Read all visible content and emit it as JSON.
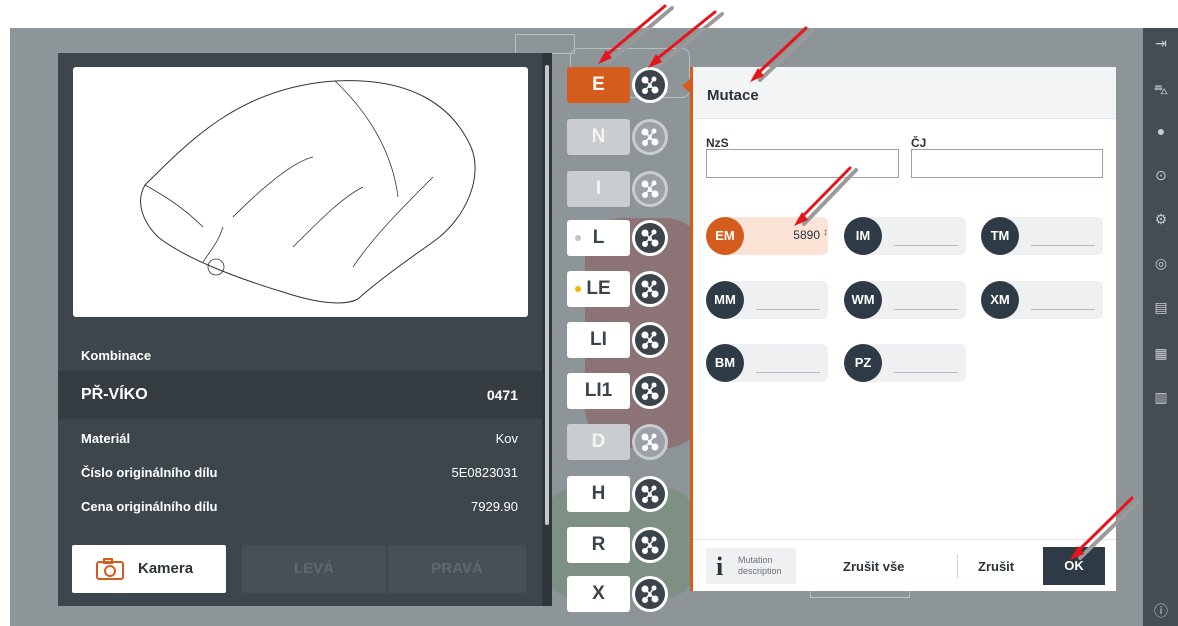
{
  "card": {
    "section_label": "Kombinace",
    "part_name": "PŘ-VÍKO",
    "part_code": "0471",
    "rows": [
      {
        "label": "Materiál",
        "value": "Kov"
      },
      {
        "label": "Číslo originálního dílu",
        "value": "5E0823031"
      },
      {
        "label": "Cena originálního dílu",
        "value": "7929.90"
      }
    ],
    "buttons": {
      "camera": "Kamera",
      "left": "LEVÁ",
      "right": "PRAVÁ"
    }
  },
  "mutation_types": [
    {
      "label": "E",
      "state": "active"
    },
    {
      "label": "N",
      "state": "disabled"
    },
    {
      "label": "I",
      "state": "disabled"
    },
    {
      "label": "L",
      "state": "normal",
      "dot": "#bfc4c7"
    },
    {
      "label": "LE",
      "state": "normal",
      "dot": "#f2b600"
    },
    {
      "label": "LI",
      "state": "normal"
    },
    {
      "label": "LI1",
      "state": "normal"
    },
    {
      "label": "D",
      "state": "disabled"
    },
    {
      "label": "H",
      "state": "normal"
    },
    {
      "label": "R",
      "state": "normal"
    },
    {
      "label": "X",
      "state": "normal"
    }
  ],
  "dialog": {
    "title": "Mutace",
    "fields": {
      "nzs_label": "NzS",
      "cj_label": "ČJ",
      "nzs_value": "",
      "cj_value": ""
    },
    "codes": [
      {
        "code": "EM",
        "value": "5890",
        "active": true
      },
      {
        "code": "IM",
        "value": ""
      },
      {
        "code": "TM",
        "value": ""
      },
      {
        "code": "MM",
        "value": ""
      },
      {
        "code": "WM",
        "value": ""
      },
      {
        "code": "XM",
        "value": ""
      },
      {
        "code": "BM",
        "value": ""
      },
      {
        "code": "PZ",
        "value": ""
      }
    ],
    "footer": {
      "mutation_desc_line1": "Mutation",
      "mutation_desc_line2": "description",
      "cancel_all": "Zrušit vše",
      "cancel": "Zrušit",
      "ok": "OK"
    }
  },
  "colors": {
    "accent": "#d45d1d",
    "dark": "#3d464d",
    "navy": "#2e3a45",
    "arrow": "#e8141b"
  }
}
